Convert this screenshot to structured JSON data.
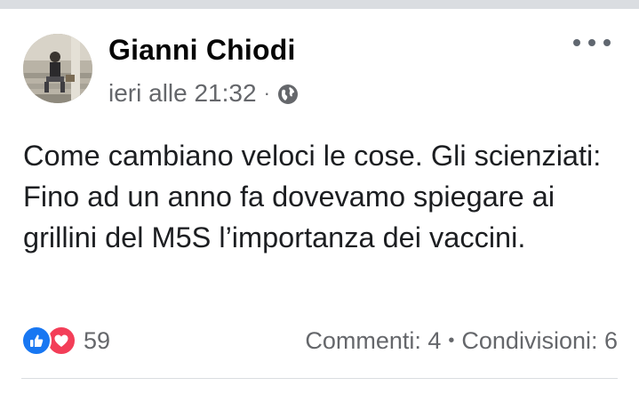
{
  "post": {
    "author": "Gianni Chiodi",
    "timestamp": "ieri alle 21:32",
    "meta_separator": "·",
    "privacy_icon": "globe-icon",
    "menu_icon": "more-options-icon",
    "text": "Come cambiano veloci le cose. Gli scienziati: Fino ad un anno fa dovevamo spiegare ai grillini del M5S l’importanza dei vaccini."
  },
  "reactions": {
    "icons": [
      "like-icon",
      "love-icon"
    ],
    "count": "59"
  },
  "stats": {
    "comments": "Commenti: 4",
    "separator": "•",
    "shares": "Condivisioni: 6"
  },
  "colors": {
    "like_blue": "#1877f2",
    "love_red": "#f33e58",
    "secondary_text": "#65676b"
  }
}
